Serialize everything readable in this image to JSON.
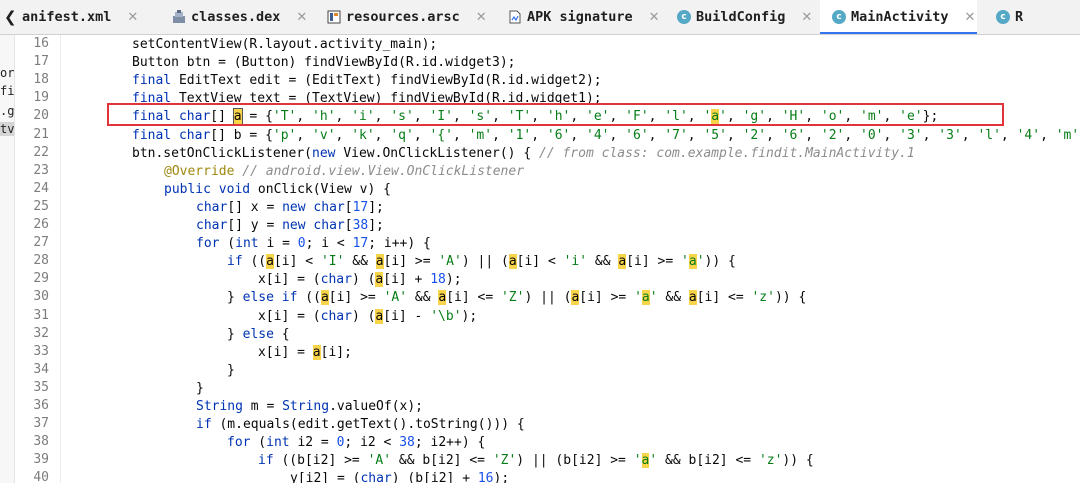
{
  "tabs": [
    {
      "label": "anifest.xml",
      "icon": "chevron-left-icon"
    },
    {
      "label": "classes.dex",
      "icon": "dex-icon"
    },
    {
      "label": "resources.arsc",
      "icon": "resources-icon"
    },
    {
      "label": "APK signature",
      "icon": "signature-icon"
    },
    {
      "label": "BuildConfig",
      "icon": "class-icon"
    },
    {
      "label": "MainActivity",
      "icon": "class-icon"
    },
    {
      "label": "R",
      "icon": "class-icon"
    }
  ],
  "tab_close_glyph": "✕",
  "class_icon_letter": "c",
  "left_strip": [
    "or",
    "fi",
    ".g",
    "tv"
  ],
  "line_numbers": [
    "16",
    "17",
    "18",
    "19",
    "20",
    "21",
    "22",
    "23",
    "24",
    "25",
    "26",
    "27",
    "28",
    "29",
    "30",
    "31",
    "32",
    "33",
    "34",
    "35",
    "36",
    "37",
    "38",
    "39",
    "40"
  ],
  "code_lines": [
    "setContentView(R.layout.activity_main);",
    "Button btn = (Button) findViewById(R.id.widget3);",
    "final EditText edit = (EditText) findViewById(R.id.widget2);",
    "final TextView text = (TextView) findViewById(R.id.widget1);",
    "final char[] a = {'T', 'h', 'i', 's', 'I', 's', 'T', 'h', 'e', 'F', 'l', 'a', 'g', 'H', 'o', 'm', 'e'};",
    "final char[] b = {'p', 'v', 'k', 'q', '{', 'm', '1', '6', '4', '6', '7', '5', '2', '6', '2', '0', '3', '3', 'l', '4', 'm'",
    "btn.setOnClickListener(new View.OnClickListener() { // from class: com.example.findit.MainActivity.1",
    "@Override // android.view.View.OnClickListener",
    "public void onClick(View v) {",
    "char[] x = new char[17];",
    "char[] y = new char[38];",
    "for (int i = 0; i < 17; i++) {",
    "if ((a[i] < 'I' && a[i] >= 'A') || (a[i] < 'i' && a[i] >= 'a')) {",
    "x[i] = (char) (a[i] + 18);",
    "} else if ((a[i] >= 'A' && a[i] <= 'Z') || (a[i] >= 'a' && a[i] <= 'z')) {",
    "x[i] = (char) (a[i] - '\\b');",
    "} else {",
    "x[i] = a[i];",
    "}",
    "}",
    "String m = String.valueOf(x);",
    "if (m.equals(edit.getText().toString())) {",
    "for (int i2 = 0; i2 < 38; i2++) {",
    "if ((b[i2] >= 'A' && b[i2] <= 'Z') || (b[i2] >= 'a' && b[i2] <= 'z')) {",
    "y[i2] = (char) (b[i2] + 16);"
  ],
  "highlighted_identifier": "a",
  "boxed_line_number": "20",
  "colors": {
    "keyword": "#0033b3",
    "string": "#067d17",
    "comment": "#8c8c8c",
    "annotation": "#9e880d",
    "number": "#1750eb",
    "highlight": "#f8d44a",
    "red_box": "#e0333a",
    "active_tab_underline": "#3574f0"
  }
}
